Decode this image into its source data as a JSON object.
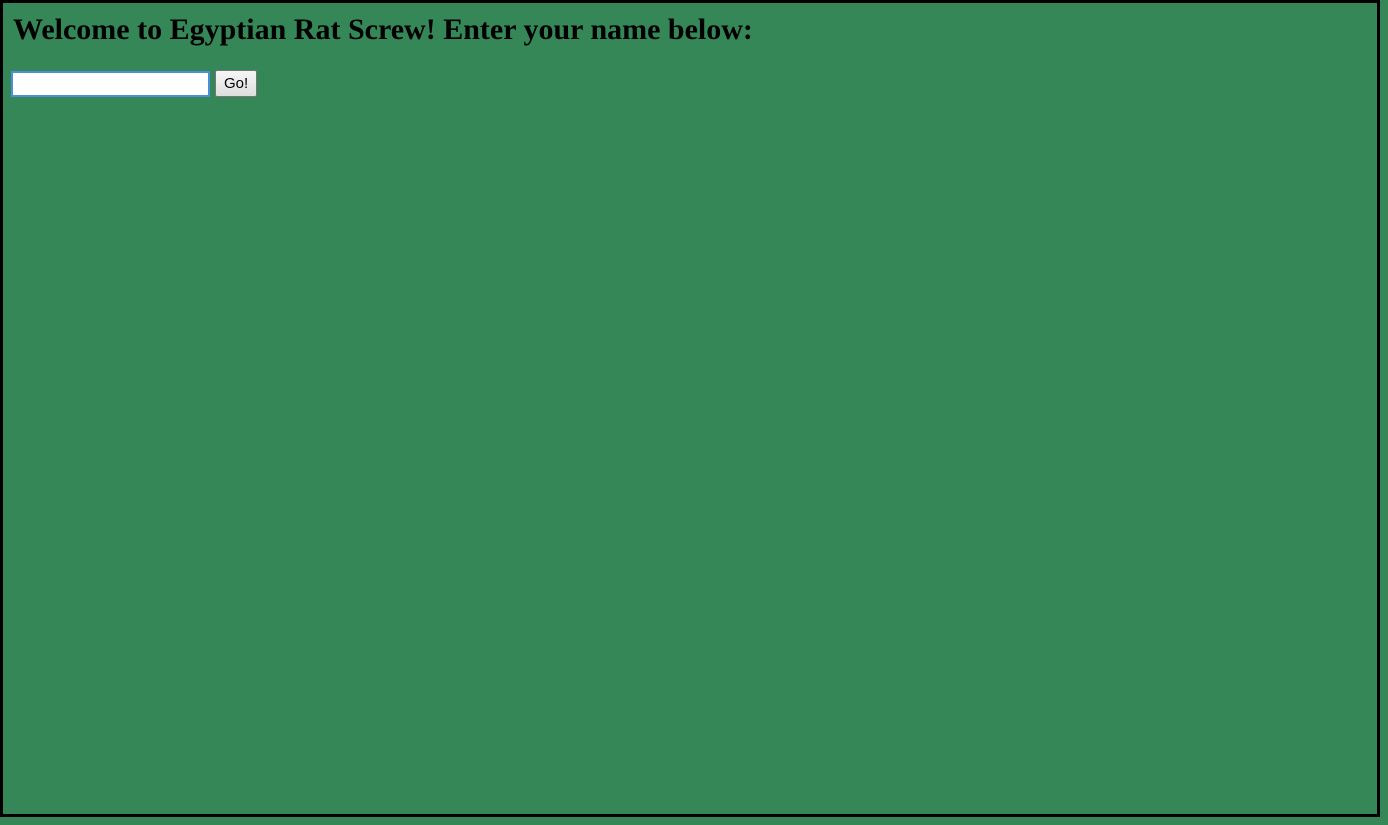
{
  "page": {
    "heading": "Welcome to Egyptian Rat Screw! Enter your name below:",
    "background_color": "#358757",
    "border_color": "#000000"
  },
  "name_form": {
    "input_value": "",
    "input_placeholder": "",
    "submit_label": "Go!"
  }
}
